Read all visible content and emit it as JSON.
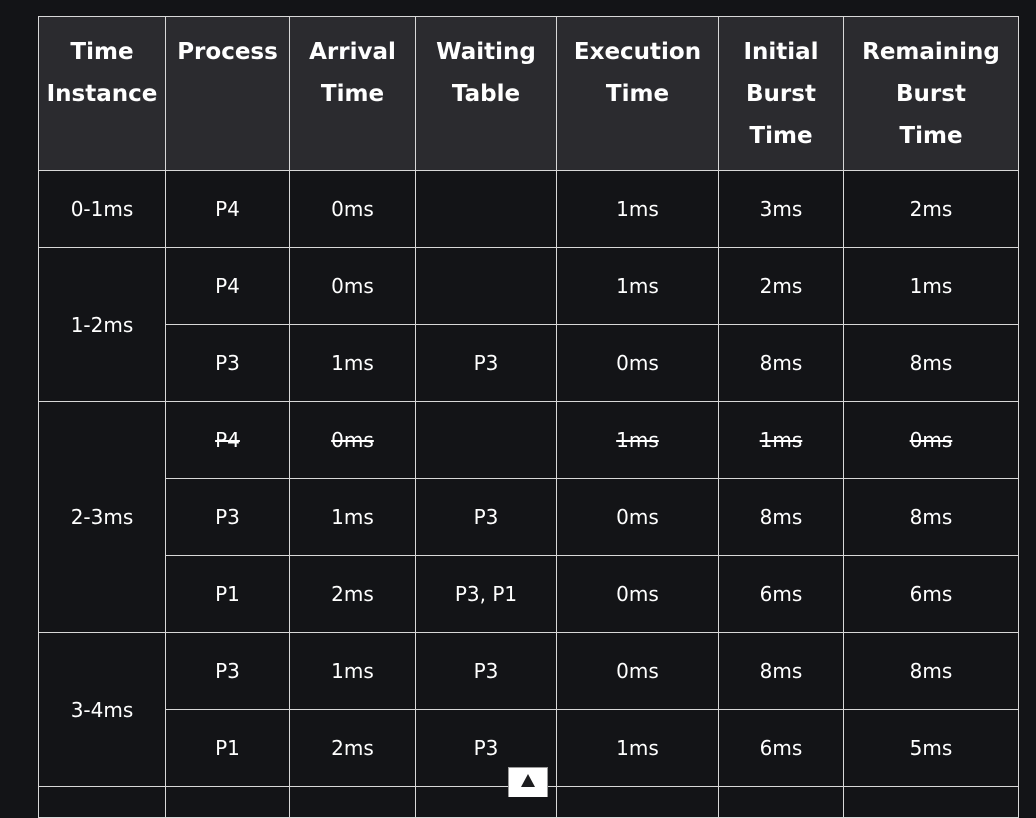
{
  "headers": [
    [
      "Time",
      "Instance"
    ],
    [
      "Process"
    ],
    [
      "Arrival",
      "Time"
    ],
    [
      "Waiting",
      "Table"
    ],
    [
      "Execution",
      "Time"
    ],
    [
      "Initial",
      "Burst",
      "Time"
    ],
    [
      "Remaining",
      "Burst",
      "Time"
    ]
  ],
  "groups": [
    {
      "time": "0-1ms",
      "rows": [
        {
          "process": "P4",
          "arrival": "0ms",
          "waiting": "",
          "execution": "1ms",
          "initial": "3ms",
          "remaining": "2ms",
          "struck": false
        }
      ]
    },
    {
      "time": "1-2ms",
      "rows": [
        {
          "process": "P4",
          "arrival": "0ms",
          "waiting": "",
          "execution": "1ms",
          "initial": "2ms",
          "remaining": "1ms",
          "struck": false
        },
        {
          "process": "P3",
          "arrival": "1ms",
          "waiting": "P3",
          "execution": "0ms",
          "initial": "8ms",
          "remaining": "8ms",
          "struck": false
        }
      ]
    },
    {
      "time": "2-3ms",
      "rows": [
        {
          "process": "P4",
          "arrival": "0ms",
          "waiting": "",
          "execution": "1ms",
          "initial": "1ms",
          "remaining": "0ms",
          "struck": true
        },
        {
          "process": "P3",
          "arrival": "1ms",
          "waiting": "P3",
          "execution": "0ms",
          "initial": "8ms",
          "remaining": "8ms",
          "struck": false
        },
        {
          "process": "P1",
          "arrival": "2ms",
          "waiting": "P3, P1",
          "execution": "0ms",
          "initial": "6ms",
          "remaining": "6ms",
          "struck": false
        }
      ]
    },
    {
      "time": "3-4ms",
      "rows": [
        {
          "process": "P3",
          "arrival": "1ms",
          "waiting": "P3",
          "execution": "0ms",
          "initial": "8ms",
          "remaining": "8ms",
          "struck": false
        },
        {
          "process": "P1",
          "arrival": "2ms",
          "waiting": "P3",
          "execution": "1ms",
          "initial": "6ms",
          "remaining": "5ms",
          "struck": false
        }
      ]
    }
  ],
  "icons": {
    "scroll_top": "arrow-up-icon"
  }
}
